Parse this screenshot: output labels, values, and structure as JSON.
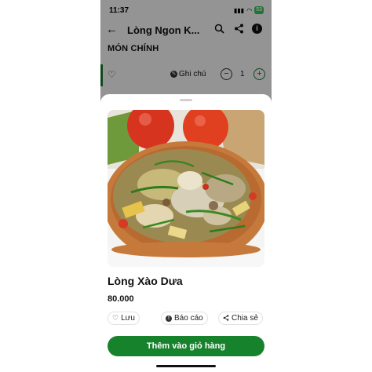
{
  "status_bar": {
    "time": "11:37",
    "battery": "53"
  },
  "header": {
    "title": "Lòng Ngon K..."
  },
  "section": {
    "title": "MÓN CHÍNH"
  },
  "item_row": {
    "note_label": "Ghi chú",
    "quantity": "1"
  },
  "sheet": {
    "dish_name": "Lòng Xào Dưa",
    "price": "80.000",
    "like_label": "Lưu",
    "report_label": "Báo cáo",
    "share_label": "Chia sẻ",
    "add_to_cart_label": "Thêm vào giỏ hàng"
  },
  "colors": {
    "accent": "#17822c",
    "overlay": "rgba(0,0,0,0.42)"
  },
  "icons": [
    "back-arrow-icon",
    "search-icon",
    "share-icon",
    "info-icon",
    "heart-icon",
    "note-icon",
    "minus-icon",
    "plus-icon",
    "report-icon"
  ]
}
